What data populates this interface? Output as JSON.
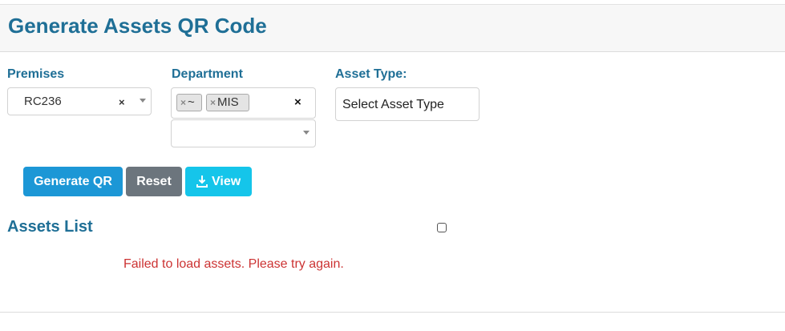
{
  "page": {
    "title": "Generate Assets QR Code"
  },
  "filters": {
    "premises": {
      "label": "Premises",
      "value": "RC236",
      "clear": "×"
    },
    "department": {
      "label": "Department",
      "tags": [
        {
          "remove": "×",
          "label": "~"
        },
        {
          "remove": "×",
          "label": "MIS"
        }
      ],
      "clear": "×"
    },
    "asset_type": {
      "label": "Asset Type:",
      "placeholder": "Select Asset Type"
    }
  },
  "actions": {
    "generate": "Generate QR",
    "reset": "Reset",
    "view": "View"
  },
  "assets": {
    "title": "Assets List",
    "error": "Failed to load assets. Please try again."
  },
  "colors": {
    "accent": "#1f6f96",
    "generate_button": "#1c97d6",
    "reset_button": "#6c757d",
    "view_button": "#15c5ea",
    "error": "#cc3333"
  }
}
